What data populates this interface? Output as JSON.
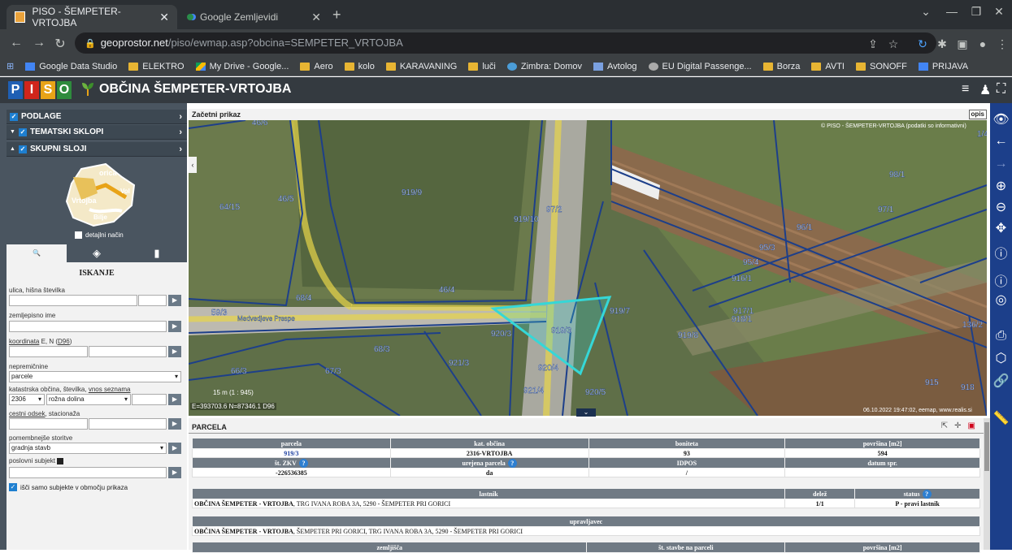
{
  "browser": {
    "tabs": [
      {
        "title": "PISO - ŠEMPETER-VRTOJBA",
        "active": true,
        "favicon": "piso-favicon"
      },
      {
        "title": "Google Zemljevidi",
        "active": false,
        "favicon": "maps-favicon"
      }
    ],
    "new_tab": "+",
    "url_host": "geoprostor.net",
    "url_path": "/piso/ewmap.asp?obcina=SEMPETER_VRTOJBA",
    "bookmarks": [
      {
        "label": "Google Data Studio",
        "icon": "gds"
      },
      {
        "label": "ELEKTRO",
        "icon": "folder"
      },
      {
        "label": "My Drive - Google...",
        "icon": "drv"
      },
      {
        "label": "Aero",
        "icon": "folder"
      },
      {
        "label": "kolo",
        "icon": "folder"
      },
      {
        "label": "KARAVANING",
        "icon": "folder"
      },
      {
        "label": "luči",
        "icon": "folder"
      },
      {
        "label": "Zimbra: Domov",
        "icon": "zim"
      },
      {
        "label": "Avtolog",
        "icon": "avt"
      },
      {
        "label": "EU Digital Passenge...",
        "icon": "eu"
      },
      {
        "label": "Borza",
        "icon": "folder"
      },
      {
        "label": "AVTI",
        "icon": "folder"
      },
      {
        "label": "SONOFF",
        "icon": "folder"
      },
      {
        "label": "PRIJAVA",
        "icon": "pri"
      }
    ]
  },
  "app": {
    "logo": [
      "P",
      "I",
      "S",
      "O"
    ],
    "logo_colors": [
      "#1f5fb4",
      "#d0251b",
      "#e8a317",
      "#2e8b3d"
    ],
    "title": "OBČINA ŠEMPETER-VRTOJBA"
  },
  "layers": [
    {
      "label": "PODLAGE",
      "expand": ""
    },
    {
      "label": "TEMATSKI SKLOPI",
      "expand": "▼"
    },
    {
      "label": "SKUPNI SLOJI",
      "expand": "▲"
    }
  ],
  "minimap": {
    "labels": [
      "orica",
      "Vrtojba",
      "Vol",
      "Bilje"
    ],
    "detail_label": "detajlni način"
  },
  "search": {
    "title": "ISKANJE",
    "street_label": "ulica, hišna številka",
    "geo_label": "zemljepisno ime",
    "coord_label": "koordinata E, N (D96)",
    "coord_link": "koordinata",
    "coord_rest": " E, N (",
    "coord_d96": "D96",
    "coord_end": ")",
    "nepremicnine_label": "nepremičnine",
    "nepremicnine_value": "parcele",
    "kat_label": "katastrska občina, številka,",
    "kat_link": "vnos seznama",
    "kat_code": "2306",
    "kat_name": "rožna dolina",
    "cestni_label": "cestni odsek",
    "cestni_rest": ", stacionaža",
    "storitve_label": "pomembnejše storitve",
    "storitve_value": "gradnja stavb",
    "subjekt_label": "poslovni subjekt",
    "only_in_view": "išči samo subjekte v območju prikaza"
  },
  "map": {
    "header": "Začetni prikaz",
    "opis": "opis",
    "copyright": "© PISO - ŠEMPETER-VRTOJBA (podatki so informativni)",
    "scale": "15 m  (1 : 945)",
    "coords": "E=393703.6  N=87346.1  D96",
    "datestamp": "06.10.2022 19:47:02, eemap, www.realis.si",
    "parcels": [
      "46/6",
      "46/5",
      "919/9",
      "919/10",
      "97/2",
      "64/15",
      "98/1",
      "97/1",
      "96/1",
      "95/3",
      "95/4",
      "916/1",
      "917/1",
      "918/1",
      "68/4",
      "46/4",
      "59/3",
      "68/3",
      "920/3",
      "919/3",
      "919/7",
      "919/8",
      "921/3",
      "67/3",
      "66/3",
      "920/4",
      "921/4",
      "920/5",
      "136/2",
      "915",
      "918",
      "1/4"
    ],
    "road_label": "Medvedjeve Prespe"
  },
  "parcela": {
    "title": "PARCELA",
    "h1": [
      "parcela",
      "kat. občina",
      "boniteta",
      "površina [m2]"
    ],
    "r1": [
      "919/3",
      "2316-VRTOJBA",
      "93",
      "594"
    ],
    "h2": [
      "št. ZKV",
      "urejena parcela",
      "IDPOS",
      "datum spr."
    ],
    "r2": [
      "-226536385",
      "da",
      "/",
      ""
    ],
    "h3": [
      "lastnik",
      "delež",
      "status"
    ],
    "owner_name": "OBČINA ŠEMPETER - VRTOJBA",
    "owner_addr": ", TRG IVANA ROBA 3A, 5290 - ŠEMPETER PRI GORICI",
    "owner_share": "1/1",
    "owner_status": "P - pravi lastnik",
    "h4": "upravljavec",
    "manager_name": "OBČINA ŠEMPETER - VRTOJBA",
    "manager_addr": ", ŠEMPETER PRI GORICI, TRG IVANA ROBA 3A, 5290 - ŠEMPETER PRI GORICI",
    "h5": [
      "zemljišča",
      "št. stavbe na parceli",
      "površina [m2]"
    ]
  }
}
